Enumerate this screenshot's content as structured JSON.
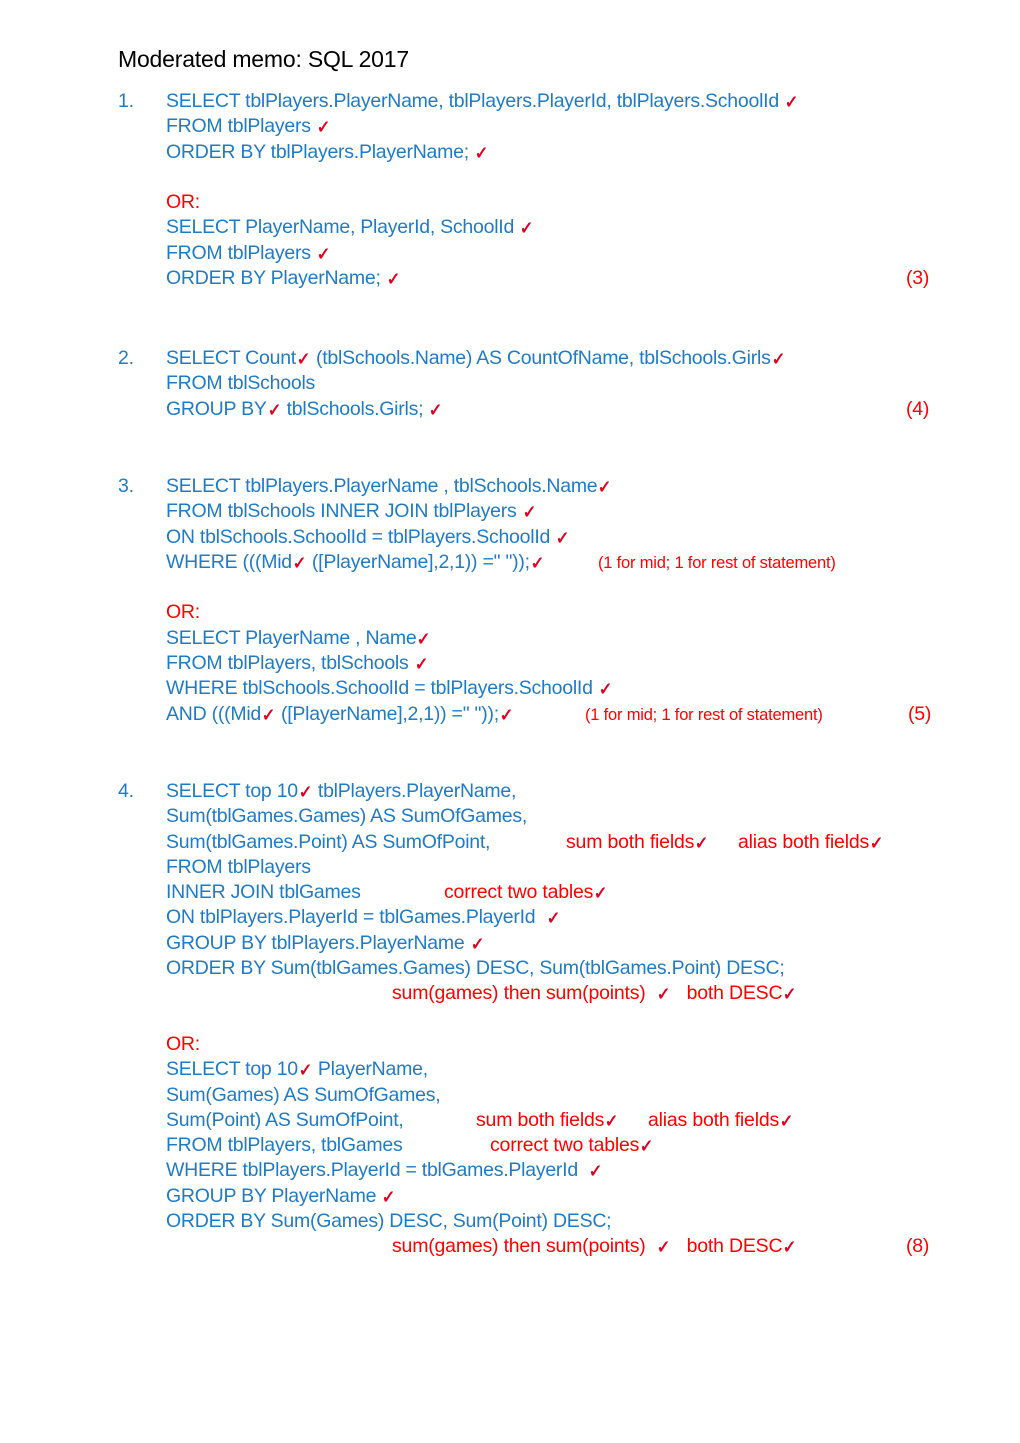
{
  "document": {
    "title": "Moderated memo: SQL 2017",
    "colors": {
      "sql_blue": "#1F7BC4",
      "marking_red": "#FF0000",
      "title_black": "#000000",
      "page_background": "#FFFFFF"
    },
    "tick_symbol": "✓"
  },
  "questions": [
    {
      "number": "1.",
      "marks": "(3)",
      "lines": [
        {
          "text": "SELECT tblPlayers.PlayerName, tblPlayers.PlayerId, tblPlayers.SchoolId ",
          "tick": true
        },
        {
          "text": "FROM tblPlayers ",
          "tick": true
        },
        {
          "text": "ORDER BY tblPlayers.PlayerName; ",
          "tick": true
        },
        {
          "text": "",
          "tick": false
        },
        {
          "text": "OR:",
          "tick": false,
          "style": "or"
        },
        {
          "text": "SELECT PlayerName, PlayerId, SchoolId ",
          "tick": true
        },
        {
          "text": "FROM tblPlayers ",
          "tick": true
        },
        {
          "text": "ORDER BY PlayerName; ",
          "tick": true,
          "marks": "(3)"
        }
      ]
    },
    {
      "number": "2.",
      "marks": "(4)",
      "lines": [
        {
          "text": "SELECT Count",
          "tick": true,
          "text_after": " (tblSchools.Name) AS CountOfName, tblSchools.Girls",
          "tick_after": true
        },
        {
          "text": "FROM tblSchools",
          "tick": false
        },
        {
          "text": "GROUP BY",
          "tick": true,
          "text_after": " tblSchools.Girls; ",
          "tick_after": true,
          "marks": "(4)"
        }
      ]
    },
    {
      "number": "3.",
      "marks": "(5)",
      "lines": [
        {
          "text": "SELECT tblPlayers.PlayerName , tblSchools.Name",
          "tick": true
        },
        {
          "text": "FROM tblSchools INNER JOIN tblPlayers ",
          "tick": true
        },
        {
          "text": "ON tblSchools.SchoolId = tblPlayers.SchoolId ",
          "tick": true
        },
        {
          "text": "WHERE (((Mid",
          "tick": true,
          "text_after": " ([PlayerName],2,1)) =\" \"));",
          "tick_after": true,
          "note": "(1 for mid; 1 for rest of statement)"
        },
        {
          "text": "",
          "tick": false
        },
        {
          "text": "OR:",
          "tick": false,
          "style": "or"
        },
        {
          "text": "SELECT PlayerName , Name",
          "tick": true
        },
        {
          "text": "FROM tblPlayers, tblSchools ",
          "tick": true
        },
        {
          "text": "WHERE tblSchools.SchoolId = tblPlayers.SchoolId ",
          "tick": true
        },
        {
          "text": "AND (((Mid",
          "tick": true,
          "text_after": " ([PlayerName],2,1)) =\" \"));",
          "tick_after": true,
          "note": "(1 for mid; 1 for rest of statement)",
          "marks": "(5)"
        }
      ]
    },
    {
      "number": "4.",
      "marks": "(8)",
      "lines": [
        {
          "text": "SELECT top 10",
          "tick": true,
          "text_after": " tblPlayers.PlayerName,"
        },
        {
          "text": "Sum(tblGames.Games) AS SumOfGames,",
          "tick": false
        },
        {
          "text": "Sum(tblGames.Point) AS SumOfPoint,",
          "tick": false,
          "note_a": "sum both fields",
          "note_a_tick": true,
          "note_b": "alias both fields",
          "note_b_tick": true
        },
        {
          "text": "FROM tblPlayers",
          "tick": false
        },
        {
          "text": "INNER JOIN tblGames",
          "tick": false,
          "note_c": "correct two tables",
          "note_c_tick": true
        },
        {
          "text": "ON tblPlayers.PlayerId = tblGames.PlayerId  ",
          "tick": true
        },
        {
          "text": "GROUP BY tblPlayers.PlayerName ",
          "tick": true
        },
        {
          "text": "ORDER BY Sum(tblGames.Games) DESC, Sum(tblGames.Point) DESC;",
          "tick": false
        },
        {
          "text": "",
          "tick": false,
          "note_d": "sum(games) then sum(points)  ",
          "note_d_tick": true,
          "note_e": "   both DESC",
          "note_e_tick": true
        },
        {
          "text": "",
          "tick": false
        },
        {
          "text": "OR:",
          "tick": false,
          "style": "or"
        },
        {
          "text": "SELECT top 10",
          "tick": true,
          "text_after": " PlayerName,"
        },
        {
          "text": "Sum(Games) AS SumOfGames,",
          "tick": false
        },
        {
          "text": "Sum(Point) AS SumOfPoint,",
          "tick": false,
          "note_a": "sum both fields",
          "note_a_tick": true,
          "note_b": "alias both fields",
          "note_b_tick": true
        },
        {
          "text": "FROM tblPlayers, tblGames",
          "tick": false,
          "note_c": "correct two tables",
          "note_c_tick": true
        },
        {
          "text": "WHERE tblPlayers.PlayerId = tblGames.PlayerId  ",
          "tick": true
        },
        {
          "text": "GROUP BY PlayerName ",
          "tick": true
        },
        {
          "text": "ORDER BY Sum(Games) DESC, Sum(Point) DESC;",
          "tick": false
        },
        {
          "text": "",
          "tick": false,
          "note_d": "sum(games) then sum(points)  ",
          "note_d_tick": true,
          "note_e": "   both DESC",
          "note_e_tick": true,
          "marks": "(8)"
        }
      ]
    }
  ]
}
